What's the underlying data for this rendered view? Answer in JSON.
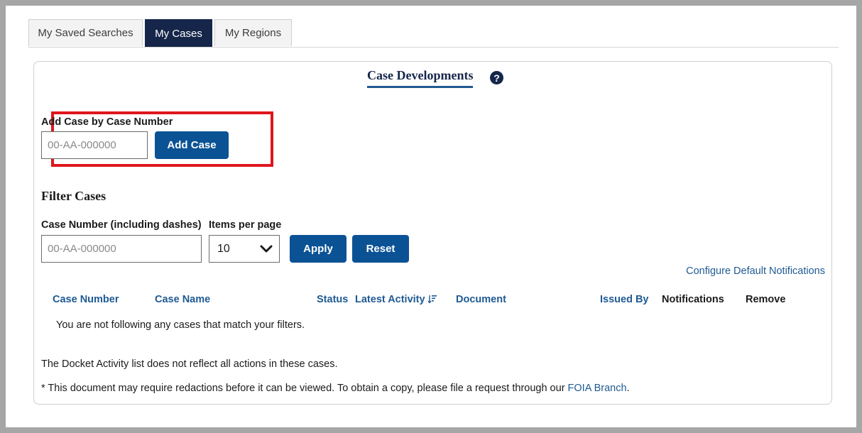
{
  "tabs": [
    "My Saved Searches",
    "My Cases",
    "My Regions"
  ],
  "active_tab": "My Cases",
  "heading": "Case Developments",
  "help_icon": "question-circle-icon",
  "add_case": {
    "label": "Add Case by Case Number",
    "placeholder": "00-AA-000000",
    "value": "",
    "button": "Add Case"
  },
  "filter": {
    "title": "Filter Cases",
    "case_number_label": "Case Number (including dashes)",
    "case_number_placeholder": "00-AA-000000",
    "case_number_value": "",
    "items_label": "Items per page",
    "items_value": "10",
    "apply": "Apply",
    "reset": "Reset"
  },
  "configure_link": "Configure Default Notifications",
  "table": {
    "columns": [
      {
        "label": "Case Number",
        "sortable": true
      },
      {
        "label": "Case Name",
        "sortable": true
      },
      {
        "label": "Status",
        "sortable": true
      },
      {
        "label": "Latest Activity",
        "sortable": true,
        "sorted": "desc"
      },
      {
        "label": "Document",
        "sortable": true
      },
      {
        "label": "Issued By",
        "sortable": true
      },
      {
        "label": "Notifications",
        "sortable": false
      },
      {
        "label": "Remove",
        "sortable": false
      }
    ],
    "empty_message": "You are not following any cases that match your filters."
  },
  "notes": {
    "docket": "The Docket Activity list does not reflect all actions in these cases.",
    "redaction_prefix": "* This document may require redactions before it can be viewed. To obtain a copy, please file a request through our ",
    "redaction_link": "FOIA Branch",
    "redaction_suffix": "."
  },
  "colors": {
    "navy": "#15264a",
    "button_blue": "#0b5295",
    "link_blue": "#1f5a93",
    "highlight_red": "#e0161c"
  }
}
